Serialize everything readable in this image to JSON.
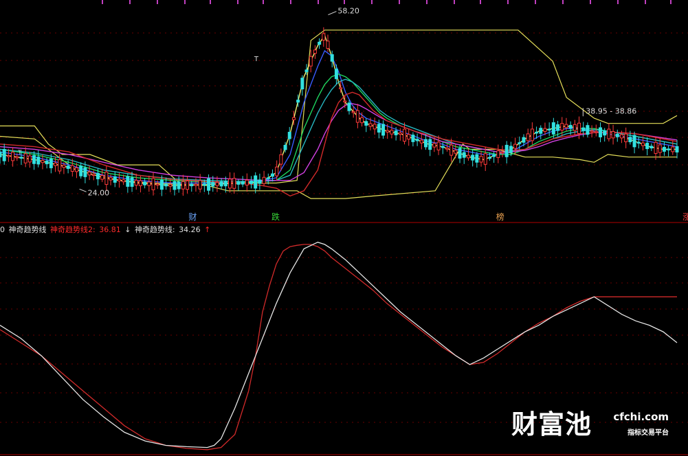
{
  "chart_data": [
    {
      "type": "candlestick",
      "title": "",
      "ylim": [
        20,
        60
      ],
      "price_labels": {
        "high": "58.20",
        "low": "24.00",
        "range": "38.95 - 38.86"
      },
      "event_labels": [
        "财",
        "跌",
        "榜",
        "涨"
      ],
      "marker_text": "T",
      "colors": {
        "up": "#ff3b3b",
        "down": "#32e0e0",
        "band": "#e6e05a",
        "ma_yellow": "#f0f070",
        "ma_blue": "#3a5cff",
        "ma_green": "#1ed760",
        "ma_cyan": "#26b6c0",
        "ma_magenta": "#d040e0",
        "ma_red": "#d22a2a"
      },
      "band_upper": [
        [
          0,
          36.5
        ],
        [
          5,
          36.5
        ],
        [
          7,
          33
        ],
        [
          9,
          31
        ],
        [
          13,
          31
        ],
        [
          17,
          29
        ],
        [
          23,
          29
        ],
        [
          26,
          25.5
        ],
        [
          40,
          25.5
        ],
        [
          43,
          26
        ],
        [
          45,
          53
        ],
        [
          47,
          55
        ],
        [
          75,
          55
        ],
        [
          80,
          49
        ],
        [
          82,
          42
        ],
        [
          86,
          38
        ],
        [
          88,
          37
        ],
        [
          96,
          37
        ],
        [
          98,
          38.5
        ]
      ],
      "band_lower": [
        [
          0,
          34.5
        ],
        [
          5,
          34
        ],
        [
          10,
          29
        ],
        [
          17,
          26
        ],
        [
          22,
          25.5
        ],
        [
          30,
          25
        ],
        [
          33,
          24
        ],
        [
          43,
          24
        ],
        [
          45,
          22.5
        ],
        [
          50,
          22.5
        ],
        [
          54,
          23
        ],
        [
          63,
          24
        ],
        [
          67,
          33
        ],
        [
          68,
          32
        ],
        [
          72,
          32
        ],
        [
          76,
          30.5
        ],
        [
          80,
          30.5
        ],
        [
          84,
          30
        ],
        [
          86,
          29.5
        ],
        [
          88,
          31
        ],
        [
          91,
          30.5
        ],
        [
          96,
          30.5
        ],
        [
          98,
          30.5
        ]
      ],
      "series": [
        {
          "name": "",
          "color": "#f0f070",
          "x": [
            0,
            5,
            10,
            15,
            20,
            25,
            30,
            35,
            38,
            40,
            42,
            44,
            46,
            47,
            48,
            49,
            50,
            51,
            52,
            53,
            54,
            55,
            56,
            58,
            60,
            62,
            64,
            66,
            68,
            70,
            72,
            74,
            76,
            78,
            80,
            82,
            84,
            86,
            88,
            90,
            92,
            94,
            96,
            98
          ],
          "values": [
            31,
            30,
            28.5,
            26.5,
            25.5,
            25,
            25.2,
            25.5,
            25.8,
            27.5,
            35,
            46,
            52,
            54,
            50,
            45,
            41,
            39.5,
            38,
            37,
            36.5,
            36,
            35.5,
            35,
            34,
            33,
            32.5,
            31.5,
            30.5,
            30,
            31,
            32,
            34,
            35.5,
            36,
            36.5,
            36,
            35.5,
            35,
            34.5,
            33.5,
            32.5,
            32,
            32
          ]
        },
        {
          "name": "",
          "color": "#3a5cff",
          "x": [
            0,
            5,
            10,
            15,
            20,
            25,
            30,
            35,
            38,
            40,
            42,
            44,
            46,
            47,
            48,
            49,
            50,
            51,
            52,
            53,
            54,
            55,
            56,
            58,
            60,
            62,
            64,
            66,
            68,
            70,
            72,
            74,
            76,
            78,
            80,
            82,
            84,
            86,
            88,
            90,
            92,
            94,
            96,
            98
          ],
          "values": [
            31.5,
            30.5,
            29,
            27,
            26,
            25.5,
            25.5,
            25.6,
            26,
            26.5,
            31,
            41,
            48,
            51,
            50,
            47,
            43,
            40.5,
            39,
            38,
            37.5,
            37,
            36.5,
            35.5,
            34.5,
            33.5,
            33,
            32,
            31.5,
            31,
            31,
            31.5,
            33,
            34.5,
            35.5,
            36,
            36,
            35.5,
            35,
            34.5,
            34,
            33.5,
            33,
            32.5
          ]
        },
        {
          "name": "",
          "color": "#1ed760",
          "x": [
            0,
            5,
            10,
            15,
            20,
            25,
            30,
            35,
            38,
            40,
            42,
            44,
            46,
            47,
            48,
            49,
            50,
            51,
            52,
            53,
            54,
            55,
            56,
            58,
            60,
            62,
            64,
            66,
            68,
            70,
            72,
            74,
            76,
            78,
            80,
            82,
            84,
            86,
            88,
            90,
            92,
            94,
            96,
            98
          ],
          "values": [
            32,
            31,
            29.5,
            27.5,
            26.5,
            26,
            25.7,
            25.6,
            25.8,
            26,
            28,
            36,
            42,
            44.5,
            46,
            46.5,
            46,
            45,
            43.5,
            42,
            40.5,
            39,
            38,
            36.5,
            35.5,
            34.5,
            33.5,
            32.5,
            32,
            31.5,
            31,
            31,
            32,
            33.5,
            34.5,
            35.5,
            36,
            36,
            35.5,
            35,
            34.5,
            34,
            33.5,
            33
          ]
        },
        {
          "name": "",
          "color": "#26b6c0",
          "x": [
            0,
            5,
            10,
            15,
            20,
            25,
            30,
            35,
            38,
            40,
            42,
            44,
            46,
            47,
            48,
            49,
            50,
            51,
            52,
            53,
            54,
            55,
            56,
            58,
            60,
            62,
            64,
            66,
            68,
            70,
            72,
            74,
            76,
            78,
            80,
            82,
            84,
            86,
            88,
            90,
            92,
            94,
            96,
            98
          ],
          "values": [
            32,
            31.3,
            30,
            28,
            27,
            26.3,
            26,
            25.8,
            25.8,
            26,
            27,
            33,
            39,
            41.5,
            43.5,
            45,
            45.5,
            45,
            44,
            42.5,
            41,
            39.5,
            38.5,
            37,
            36,
            35,
            34,
            33,
            32.5,
            32,
            31.5,
            31.5,
            32,
            33,
            34,
            35,
            35.5,
            35.8,
            35.5,
            35,
            34.5,
            34,
            33.5,
            33
          ]
        },
        {
          "name": "",
          "color": "#d040e0",
          "x": [
            0,
            5,
            10,
            15,
            20,
            25,
            30,
            35,
            38,
            40,
            42,
            44,
            46,
            47,
            48,
            49,
            50,
            51,
            52,
            53,
            54,
            55,
            56,
            58,
            60,
            62,
            64,
            66,
            68,
            70,
            72,
            74,
            76,
            78,
            80,
            82,
            84,
            86,
            88,
            90,
            92,
            94,
            96,
            98
          ],
          "values": [
            32.5,
            32,
            31,
            29.5,
            28,
            27,
            26.5,
            26.2,
            26,
            26,
            26,
            27.5,
            32,
            35,
            37.5,
            39.5,
            40.5,
            40.8,
            40.5,
            39.8,
            39,
            38.2,
            37.5,
            36.5,
            35.5,
            34.5,
            33.5,
            33,
            32.5,
            32,
            31.5,
            31.5,
            31.8,
            32.5,
            33.5,
            34.2,
            34.8,
            35.2,
            35.3,
            35.2,
            35,
            34.6,
            34.2,
            33.8
          ]
        },
        {
          "name": "",
          "color": "#d22a2a",
          "x": [
            0,
            5,
            10,
            15,
            20,
            25,
            30,
            35,
            38,
            40,
            42,
            44,
            46,
            47,
            48,
            49,
            50,
            51,
            52,
            53,
            54,
            55,
            56,
            58,
            60,
            62,
            64,
            66,
            68,
            70,
            72,
            74,
            76,
            78,
            80,
            82,
            84,
            86,
            88,
            90,
            92,
            94,
            96,
            98
          ],
          "values": [
            33,
            32.5,
            31.5,
            29,
            27,
            26.2,
            25.8,
            25.5,
            25,
            24.5,
            23,
            24,
            28,
            33,
            38,
            41,
            42.5,
            43,
            42.5,
            41,
            39.5,
            38.5,
            37.5,
            36.5,
            35.5,
            34.8,
            34,
            33.5,
            33,
            32.5,
            32,
            31.8,
            32,
            33,
            34,
            34.5,
            35,
            35.2,
            35.3,
            35.2,
            35,
            34.5,
            34,
            33.5
          ]
        }
      ]
    },
    {
      "type": "line",
      "title": "",
      "ylim": [
        0,
        50
      ],
      "legend": {
        "prefix": "0",
        "name1": "神奇趋势线",
        "name2_label": "神奇趋势线2:",
        "name2_value": "36.81",
        "name2_arrow": "↓",
        "name3_label": "神奇趋势线:",
        "name3_value": "34.26",
        "name3_arrow": "↑"
      },
      "series": [
        {
          "name": "神奇趋势线2",
          "color": "#d22a2a",
          "x": [
            0,
            3,
            6,
            9,
            12,
            15,
            18,
            21,
            24,
            27,
            30,
            32,
            34,
            36,
            37,
            38,
            39,
            40,
            41,
            42,
            43,
            44,
            45,
            46,
            47,
            48,
            50,
            52,
            54,
            56,
            58,
            60,
            62,
            64,
            66,
            68,
            70,
            72,
            74,
            76,
            78,
            80,
            82,
            84,
            86,
            88,
            90,
            92,
            94,
            96,
            98
          ],
          "values": [
            28,
            25,
            22,
            18,
            14,
            10,
            6,
            3,
            1.5,
            0.8,
            0.5,
            1,
            4,
            14,
            22,
            32,
            38,
            43,
            46,
            47,
            47.3,
            47.5,
            47.5,
            47,
            46,
            44.5,
            42,
            39.5,
            37,
            34,
            31.5,
            29,
            26.5,
            24,
            22,
            20,
            20.5,
            22.5,
            25,
            27.5,
            29.5,
            31,
            33,
            34.5,
            35.5,
            35.5,
            35.5,
            35.5,
            35.5,
            35.5,
            35.5
          ]
        },
        {
          "name": "神奇趋势线",
          "color": "#e6e6e6",
          "x": [
            0,
            3,
            6,
            9,
            12,
            15,
            18,
            21,
            24,
            27,
            30,
            31,
            32,
            34,
            36,
            38,
            40,
            42,
            44,
            46,
            47,
            48,
            50,
            52,
            54,
            56,
            58,
            60,
            62,
            64,
            66,
            68,
            70,
            72,
            74,
            76,
            78,
            80,
            82,
            84,
            86,
            88,
            90,
            92,
            94,
            96,
            98
          ],
          "values": [
            29,
            26,
            22,
            17,
            12,
            8,
            4.5,
            2.5,
            1.5,
            1.2,
            1,
            1.5,
            3,
            10,
            18,
            26,
            34,
            41,
            46.5,
            48,
            47.5,
            46.5,
            44,
            41,
            38,
            35,
            32,
            29.5,
            27,
            24.5,
            22,
            20,
            21.5,
            23.5,
            25.5,
            27.5,
            29,
            31,
            32.5,
            34,
            35.5,
            33.5,
            31.5,
            30,
            29,
            27.5,
            25
          ]
        }
      ]
    }
  ],
  "watermark": {
    "brand": "财富池",
    "site": "cfchi.com",
    "tagline": "指标交易平台"
  }
}
